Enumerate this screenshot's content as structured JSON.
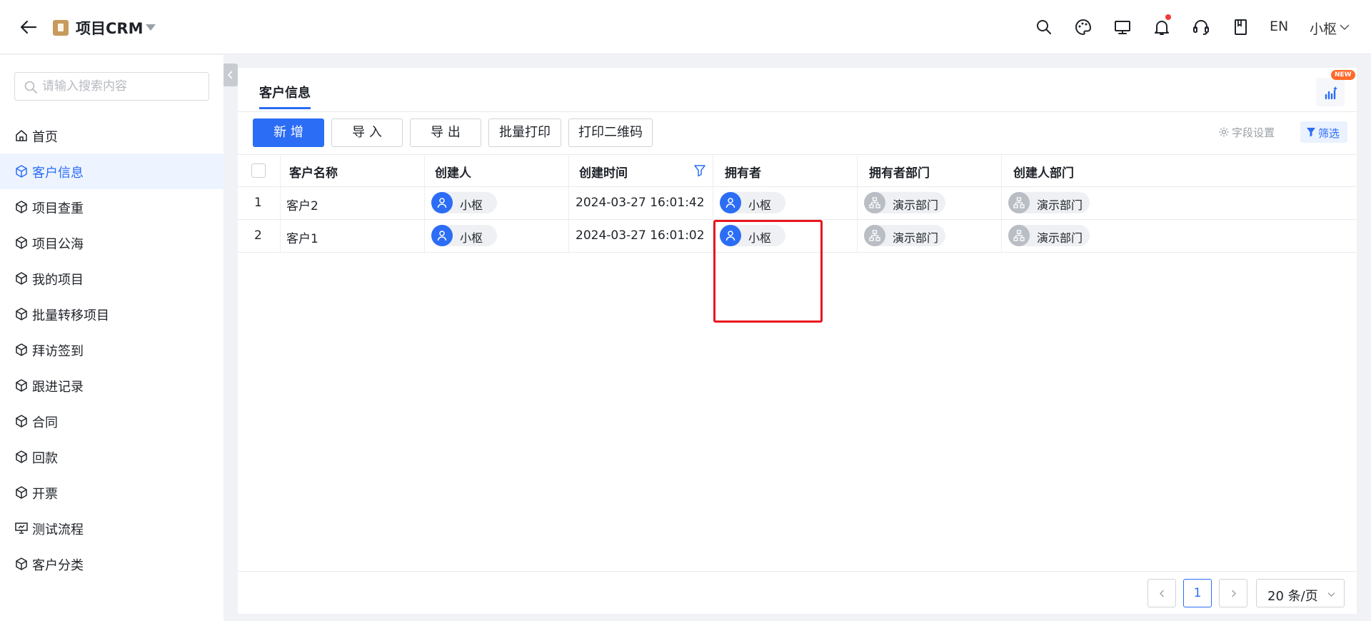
{
  "header": {
    "app_title": "项目CRM",
    "lang": "EN",
    "user": "小枢",
    "icons": [
      "back-arrow-icon",
      "app-logo-icon",
      "search-icon",
      "palette-icon",
      "monitor-icon",
      "bell-icon",
      "headset-icon",
      "book-icon"
    ]
  },
  "sidebar": {
    "search_placeholder": "请输入搜索内容",
    "items": [
      {
        "label": "首页",
        "icon": "home-icon"
      },
      {
        "label": "客户信息",
        "icon": "cube-icon",
        "active": true
      },
      {
        "label": "项目查重",
        "icon": "cube-icon"
      },
      {
        "label": "项目公海",
        "icon": "cube-icon"
      },
      {
        "label": "我的项目",
        "icon": "cube-icon"
      },
      {
        "label": "批量转移项目",
        "icon": "cube-icon"
      },
      {
        "label": "拜访签到",
        "icon": "cube-icon"
      },
      {
        "label": "跟进记录",
        "icon": "cube-icon"
      },
      {
        "label": "合同",
        "icon": "cube-icon"
      },
      {
        "label": "回款",
        "icon": "cube-icon"
      },
      {
        "label": "开票",
        "icon": "cube-icon"
      },
      {
        "label": "测试流程",
        "icon": "presentation-icon"
      },
      {
        "label": "客户分类",
        "icon": "cube-icon"
      }
    ]
  },
  "main": {
    "tab": "客户信息",
    "new_badge": "NEW",
    "toolbar": {
      "add": "新 增",
      "import": "导 入",
      "export": "导 出",
      "batch_print": "批量打印",
      "print_qr": "打印二维码",
      "field_settings": "字段设置",
      "filter": "筛选"
    },
    "table": {
      "columns": [
        "客户名称",
        "创建人",
        "创建时间",
        "拥有者",
        "拥有者部门",
        "创建人部门"
      ],
      "rows": [
        {
          "index": "1",
          "name": "客户2",
          "creator": "小枢",
          "created_at": "2024-03-27 16:01:42",
          "owner": "小枢",
          "owner_dept": "演示部门",
          "creator_dept": "演示部门"
        },
        {
          "index": "2",
          "name": "客户1",
          "creator": "小枢",
          "created_at": "2024-03-27 16:01:02",
          "owner": "小枢",
          "owner_dept": "演示部门",
          "creator_dept": "演示部门"
        }
      ]
    },
    "pagination": {
      "current_page": "1",
      "page_size": "20 条/页"
    }
  },
  "colors": {
    "accent": "#2b6df5",
    "highlight": "#e8161f",
    "notify": "#f03a3a"
  }
}
